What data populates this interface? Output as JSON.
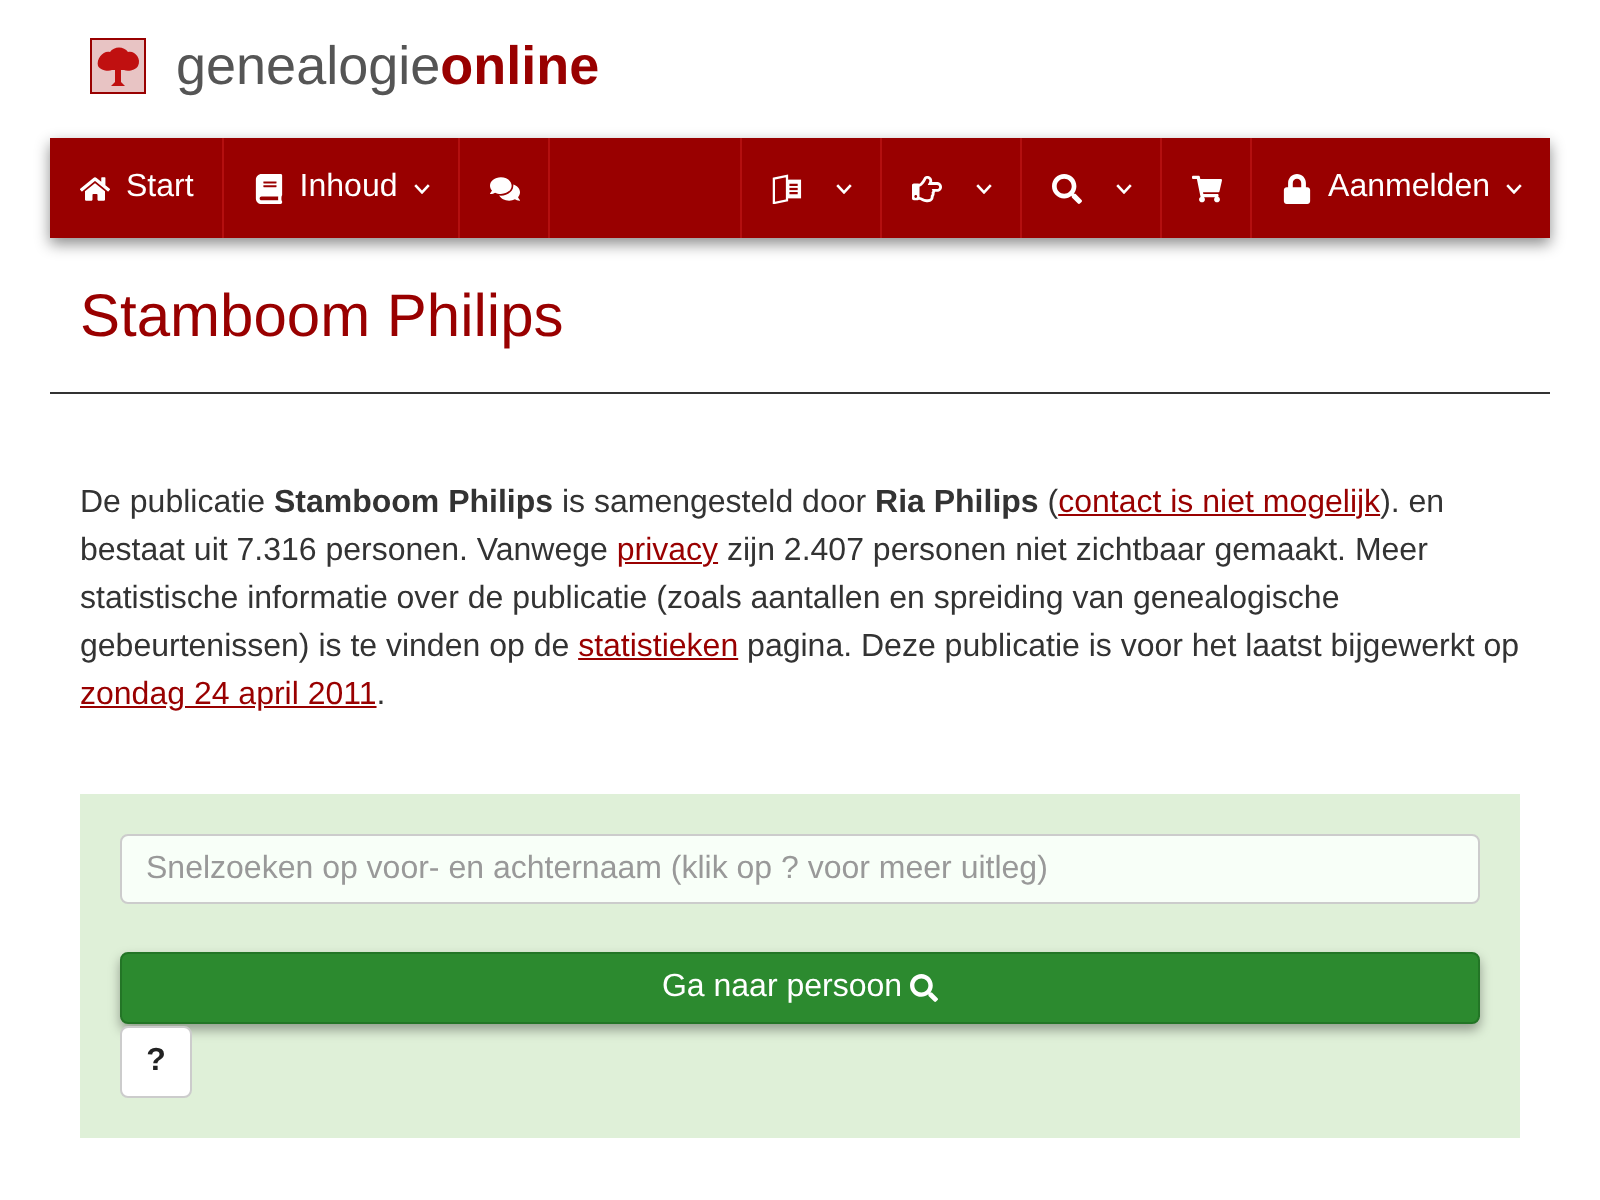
{
  "logo": {
    "wordmark": "genealogie**online**"
  },
  "nav": {
    "left": [
      {
        "label": "Start",
        "dropdown": false
      },
      {
        "label": "Inhoud",
        "dropdown": true
      },
      {
        "dropdown": false
      }
    ],
    "right": [
      {
        "dropdown": true
      },
      {
        "dropdown": true
      },
      {
        "dropdown": true
      },
      {
        "dropdown": false
      },
      {
        "label": "Aanmelden",
        "dropdown": true
      }
    ]
  },
  "title": "Stamboom Philips",
  "description": [
    {
      "kind": "text",
      "text": "De publicatie **Stamboom Philips** is samengesteld door **Ria Philips** ("
    },
    {
      "kind": "link",
      "text": "contact is niet mogelijk"
    },
    {
      "kind": "text",
      "text": "). en bestaat uit 7.316 personen. Vanwege "
    },
    {
      "kind": "link",
      "text": "privacy"
    },
    {
      "kind": "text",
      "text": " zijn 2.407 personen niet zichtbaar gemaakt. Meer statistische informatie over de publicatie (zoals aantallen en spreiding van genealogische gebeurtenissen) is te vinden op de "
    },
    {
      "kind": "link",
      "text": "statistieken"
    },
    {
      "kind": "text",
      "text": " pagina. Deze publicatie is voor het laatst bijgewerkt op "
    },
    {
      "kind": "link",
      "text": "zondag 24 april 2011"
    },
    {
      "kind": "text",
      "text": "."
    }
  ],
  "quick_search": {
    "placeholder": "Snelzoeken op voor- en achternaam (klik op ? voor meer uitleg)",
    "submit": "Ga naar persoon",
    "help": "?"
  }
}
